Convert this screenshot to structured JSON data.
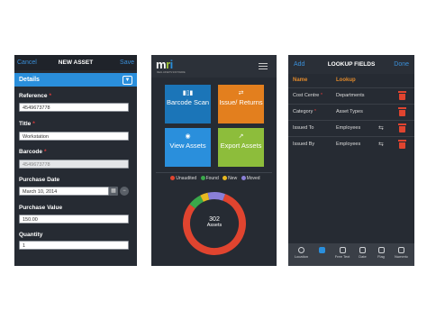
{
  "new_asset": {
    "nav": {
      "cancel": "Cancel",
      "title": "NEW ASSET",
      "save": "Save"
    },
    "section": "Details",
    "fields": [
      {
        "label": "Reference",
        "required": "*",
        "value": "4549673778"
      },
      {
        "label": "Title",
        "required": "*",
        "value": "Workstation"
      },
      {
        "label": "Barcode",
        "required": "*",
        "value": "4549673778"
      },
      {
        "label": "Purchase Date",
        "required": "",
        "value": "March 10, 2014"
      },
      {
        "label": "Purchase Value",
        "required": "",
        "value": "150.00"
      },
      {
        "label": "Quantity",
        "required": "",
        "value": "1"
      }
    ]
  },
  "dashboard": {
    "logo": {
      "m": "m",
      "r": "r",
      "i": "i"
    },
    "logo_sub": "REAL ASSETS SOFTWARE",
    "tiles": [
      {
        "icon": "barcode-icon",
        "label": "Barcode Scan",
        "color": "#1b75b8"
      },
      {
        "icon": "transfer-icon",
        "label": "Issue/ Returns",
        "color": "#e37f1e"
      },
      {
        "icon": "eye-icon",
        "label": "View Assets",
        "color": "#2a8fdc"
      },
      {
        "icon": "export-icon",
        "label": "Export Assets",
        "color": "#8dbd3b"
      }
    ],
    "legend": [
      {
        "label": "Unaudited",
        "color": "#e0442f"
      },
      {
        "label": "Found",
        "color": "#3aa84a"
      },
      {
        "label": "New",
        "color": "#e8b820"
      },
      {
        "label": "Moved",
        "color": "#8a7fd8"
      }
    ],
    "donut": {
      "total": "302",
      "unit": "Assets",
      "fractions": [
        0.8,
        0.07,
        0.04,
        0.09
      ]
    }
  },
  "lookup_fields": {
    "nav": {
      "add": "Add",
      "title": "LOOKUP FIELDS",
      "done": "Done"
    },
    "columns": {
      "name": "Name",
      "lookup": "Lookup"
    },
    "rows": [
      {
        "name": "Cost Centre",
        "required": "*",
        "lookup": "Departments",
        "swap": false
      },
      {
        "name": "Category",
        "required": "*",
        "lookup": "Asset Types",
        "swap": false
      },
      {
        "name": "Issued To",
        "required": "",
        "lookup": "Employees",
        "swap": true
      },
      {
        "name": "Issued By",
        "required": "",
        "lookup": "Employees",
        "swap": true
      }
    ],
    "tabs": [
      {
        "label": "Location",
        "icon": "globe-icon",
        "active": false
      },
      {
        "label": "",
        "icon": "list-icon",
        "active": true
      },
      {
        "label": "Free Text",
        "icon": "text-icon",
        "active": false
      },
      {
        "label": "Date",
        "icon": "calendar-icon",
        "active": false
      },
      {
        "label": "Flag",
        "icon": "flag-icon",
        "active": false
      },
      {
        "label": "Numeric",
        "icon": "numeric-icon",
        "active": false
      }
    ]
  }
}
